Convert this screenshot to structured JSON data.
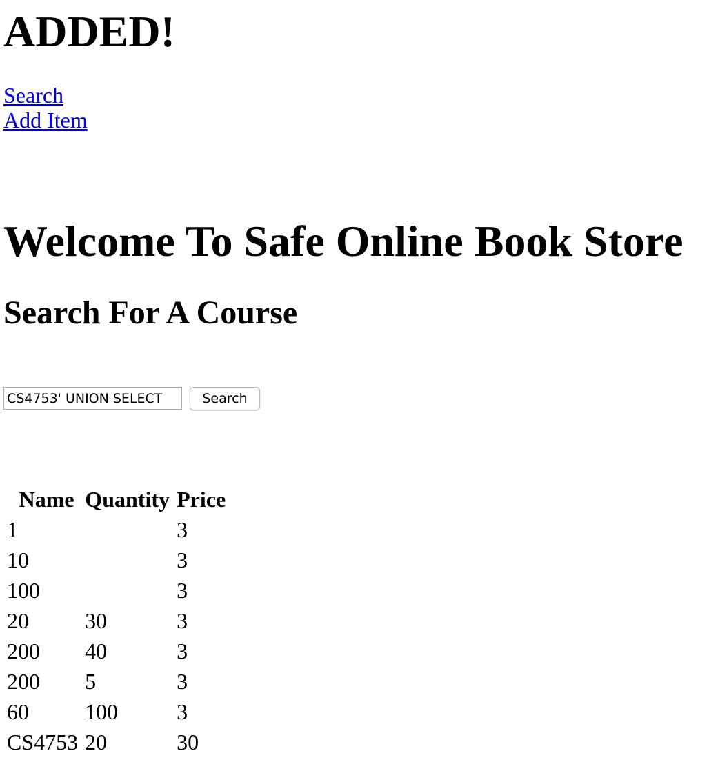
{
  "status": {
    "message": "ADDED!"
  },
  "nav": {
    "search_label": "Search",
    "add_item_label": "Add Item",
    "link_color": "#0000ee"
  },
  "page": {
    "title": "Welcome To Safe Online Book Store",
    "subtitle": "Search For A Course"
  },
  "search": {
    "input_value": "CS4753' UNION SELECT",
    "button_label": "Search"
  },
  "results": {
    "headers": [
      "Name",
      "Quantity",
      "Price"
    ],
    "rows": [
      {
        "name": "1",
        "quantity": "",
        "price": "3"
      },
      {
        "name": "10",
        "quantity": "",
        "price": "3"
      },
      {
        "name": "100",
        "quantity": "",
        "price": "3"
      },
      {
        "name": "20",
        "quantity": "30",
        "price": "3"
      },
      {
        "name": "200",
        "quantity": "40",
        "price": "3"
      },
      {
        "name": "200",
        "quantity": "5",
        "price": "3"
      },
      {
        "name": "60",
        "quantity": "100",
        "price": "3"
      },
      {
        "name": "CS4753",
        "quantity": "20",
        "price": "30"
      }
    ]
  }
}
